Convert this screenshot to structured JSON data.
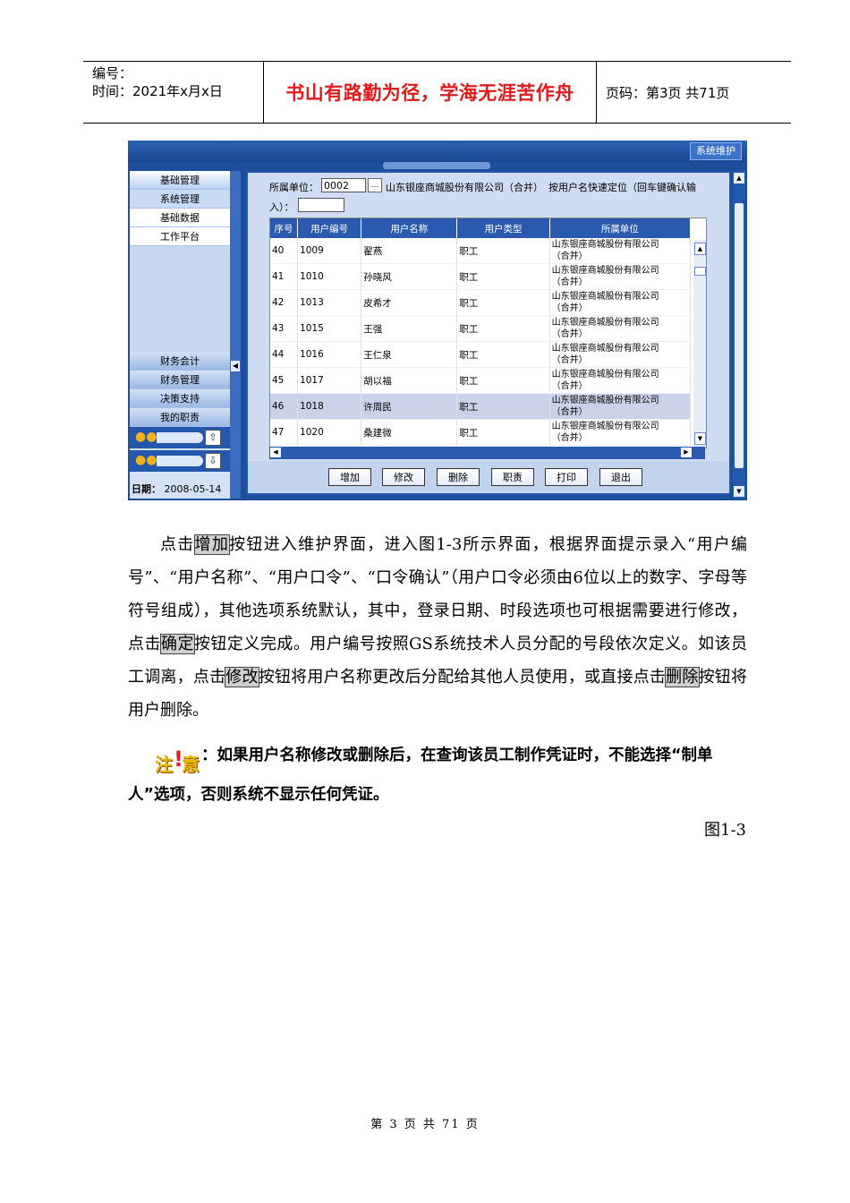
{
  "header": {
    "number_label": "编号：",
    "time_label": "时间：2021年x月x日",
    "motto": "书山有路勤为径，学海无涯苦作舟",
    "page_label": "页码：第3页  共71页"
  },
  "screenshot": {
    "system_button": "系统维护",
    "nav": {
      "items": [
        "基础管理",
        "系统管理",
        "基础数据",
        "工作平台"
      ],
      "bottom_items": [
        "财务会计",
        "财务管理",
        "决策支持",
        "我的职责"
      ],
      "date_label": "日期：",
      "date_value": "2008-05-14"
    },
    "filter": {
      "unit_label": "所属单位：",
      "unit_code": "0002",
      "lookup_glyph": "…",
      "unit_name": "山东银座商城股份有限公司（合并）",
      "locate_label": "按用户名快速定位（回车键确认输",
      "locate_label_cont": "入）："
    },
    "columns": [
      "序号",
      "用户编号",
      "用户名称",
      "用户类型",
      "所属单位"
    ],
    "rows": [
      {
        "seq": "40",
        "code": "1009",
        "name": "翟燕",
        "type": "职工",
        "unit": "山东银座商城股份有限公司",
        "unit2": "（合并）"
      },
      {
        "seq": "41",
        "code": "1010",
        "name": "孙晓风",
        "type": "职工",
        "unit": "山东银座商城股份有限公司",
        "unit2": "（合并）"
      },
      {
        "seq": "42",
        "code": "1013",
        "name": "皮希才",
        "type": "职工",
        "unit": "山东银座商城股份有限公司",
        "unit2": "（合并）"
      },
      {
        "seq": "43",
        "code": "1015",
        "name": "王强",
        "type": "职工",
        "unit": "山东银座商城股份有限公司",
        "unit2": "（合并）"
      },
      {
        "seq": "44",
        "code": "1016",
        "name": "王仁泉",
        "type": "职工",
        "unit": "山东银座商城股份有限公司",
        "unit2": "（合并）"
      },
      {
        "seq": "45",
        "code": "1017",
        "name": "胡以福",
        "type": "职工",
        "unit": "山东银座商城股份有限公司",
        "unit2": "（合并）"
      },
      {
        "seq": "46",
        "code": "1018",
        "name": "许周民",
        "type": "职工",
        "unit": "山东银座商城股份有限公司",
        "unit2": "（合并）"
      },
      {
        "seq": "47",
        "code": "1020",
        "name": "桑建微",
        "type": "职工",
        "unit": "山东银座商城股份有限公司",
        "unit2": "（合并）"
      }
    ],
    "buttons": [
      "增加",
      "修改",
      "删除",
      "职责",
      "打印",
      "退出"
    ]
  },
  "body": {
    "p1": "点击",
    "h_add": "增加",
    "p2": "按钮进入维护界面，进入图1-3所示界面，根据界面提示录入“用户编号”、“用户名称”、“用户口令”、“口令确认”（用户口令必须由6位以上的数字、字母等符号组成），其他选项系统默认，其中，登录日期、时段选项也可根据需要进行修改，  点击",
    "h_ok": "确定",
    "p3": "按钮定义完成。用户编号按照GS系统技术人员分配的号段依次定义。如该员工调离，点击",
    "h_edit": "修改",
    "p4": "按钮将用户名称更改后分配给其他人员使用，或直接点击",
    "h_del": "删除",
    "p5": "按钮将用户删除。"
  },
  "note": {
    "icon_left": "注",
    "icon_bang": "!",
    "icon_right": "意",
    "text": "：如果用户名称修改或删除后，在查询该员工制作凭证时，不能选择“制单人”选项，否则系统不显示任何凭证。"
  },
  "figure_label": "图1-3",
  "footer": "第 3 页 共 71 页"
}
